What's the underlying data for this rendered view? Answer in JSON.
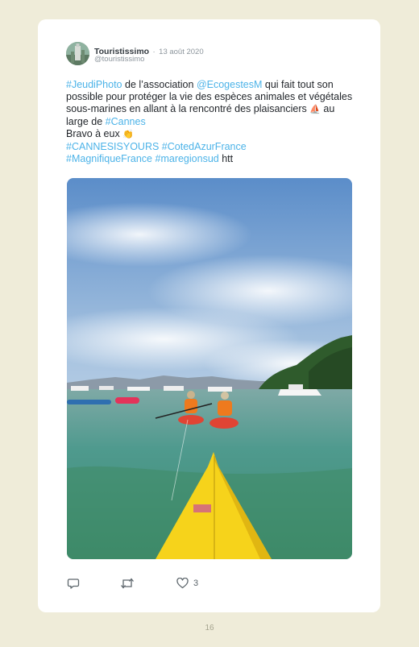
{
  "post": {
    "author_name": "Touristissimo",
    "separator": "·",
    "date": "13 août 2020",
    "handle": "@touristissimo",
    "text": {
      "tag_jeudiphoto": "#JeudiPhoto",
      "part1": " de l’association ",
      "mention": "@EcogestesM",
      "part2": " qui fait tout son possible pour protéger la vie des espèces animales et végétales sous-marines en allant à la rencontré des plaisanciers ",
      "part3": " au large de ",
      "tag_cannes": "#Cannes",
      "line_bravo": "Bravo à eux ",
      "tag_cannesisyours": "#CANNESISYOURS",
      "tag_cotedazur": "#CotedAzurFrance",
      "tag_magnifique": "#MagnifiqueFrance",
      "tag_maregionsud": "#maregionsud",
      "trailing": " htt"
    },
    "emoji_boat": "⛵",
    "emoji_clap": "👏",
    "like_count": "3"
  },
  "icons": {
    "reply": "reply-icon",
    "retweet": "retweet-icon",
    "like": "heart-icon"
  },
  "colors": {
    "background": "#efecd9",
    "card": "#ffffff",
    "link": "#4cb3e8",
    "kayak": "#f6d31b"
  },
  "page_number": "16"
}
